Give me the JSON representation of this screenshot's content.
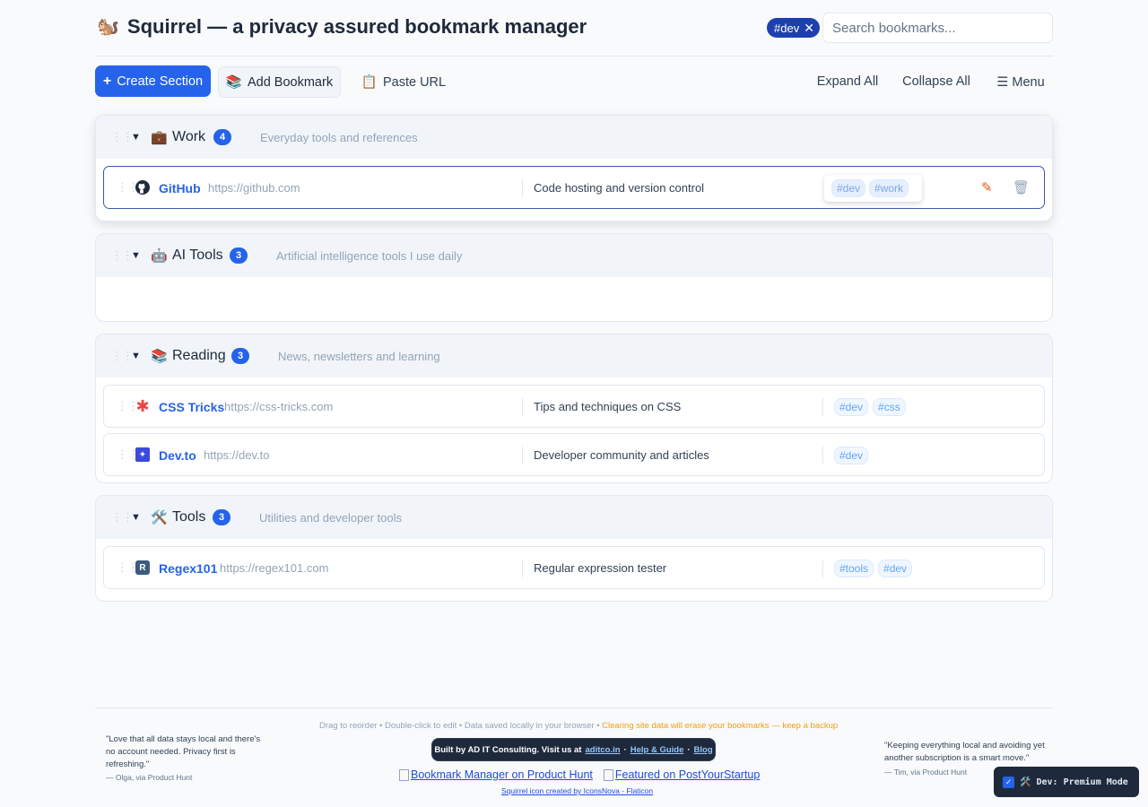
{
  "header": {
    "logo_icon": "🐿️",
    "title": "Squirrel — a privacy assured bookmark manager",
    "active_filter": "#dev",
    "search_placeholder": "Search bookmarks..."
  },
  "toolbar": {
    "create_section": "Create Section",
    "add_bookmark_icon": "📚",
    "add_bookmark": "Add Bookmark",
    "paste_url_icon": "📋",
    "paste_url": "Paste URL",
    "expand_all": "Expand All",
    "collapse_all": "Collapse All",
    "menu": "☰ Menu"
  },
  "sections": [
    {
      "icon": "💼",
      "name": "Work",
      "count": "4",
      "description": "Everyday tools and references",
      "bookmarks": [
        {
          "favicon": "github-icon",
          "title": "GitHub",
          "url": "https://github.com",
          "description": "Code hosting and version control",
          "tags": [
            "#dev",
            "#work"
          ]
        }
      ]
    },
    {
      "icon": "🤖",
      "name": "AI Tools",
      "count": "3",
      "description": "Artificial intelligence tools I use daily",
      "bookmarks": []
    },
    {
      "icon": "📚",
      "name": "Reading",
      "count": "3",
      "description": "News, newsletters and learning",
      "bookmarks": [
        {
          "favicon": "css-tricks-icon",
          "title": "CSS Tricks",
          "url": "https://css-tricks.com",
          "description": "Tips and techniques on CSS",
          "tags": [
            "#dev",
            "#css"
          ]
        },
        {
          "favicon": "devto-icon",
          "title": "Dev.to",
          "url": "https://dev.to",
          "description": "Developer community and articles",
          "tags": [
            "#dev"
          ]
        }
      ]
    },
    {
      "icon": "🛠️",
      "name": "Tools",
      "count": "3",
      "description": "Utilities and developer tools",
      "bookmarks": [
        {
          "favicon": "regex101-icon",
          "title": "Regex101",
          "url": "https://regex101.com",
          "description": "Regular expression tester",
          "tags": [
            "#tools",
            "#dev"
          ]
        }
      ]
    }
  ],
  "footer": {
    "note": "Drag to reorder • Double-click to edit • Data saved locally in your browser • ",
    "warning": "Clearing site data will erase your bookmarks — keep a backup",
    "built_text": "Built by AD IT Consulting. Visit us at",
    "built_link": "aditco.in",
    "help_link": "Help & Guide",
    "blog_link": "Blog",
    "badge_1": "Bookmark Manager on Product Hunt",
    "badge_2": "Featured on PostYourStartup",
    "credit": "Squirrel icon created by IconsNova - Flaticon",
    "quote_left": "\"Love that all data stays local and there's no account needed. Privacy first is refreshing.\"",
    "quote_left_by": "— Olga, via Product Hunt",
    "quote_right": "\"Keeping everything local and avoiding yet another subscription is a smart move.\"",
    "quote_right_by": "— Tim, via Product Hunt",
    "premium_label": "🛠️ Dev: Premium Mode"
  }
}
